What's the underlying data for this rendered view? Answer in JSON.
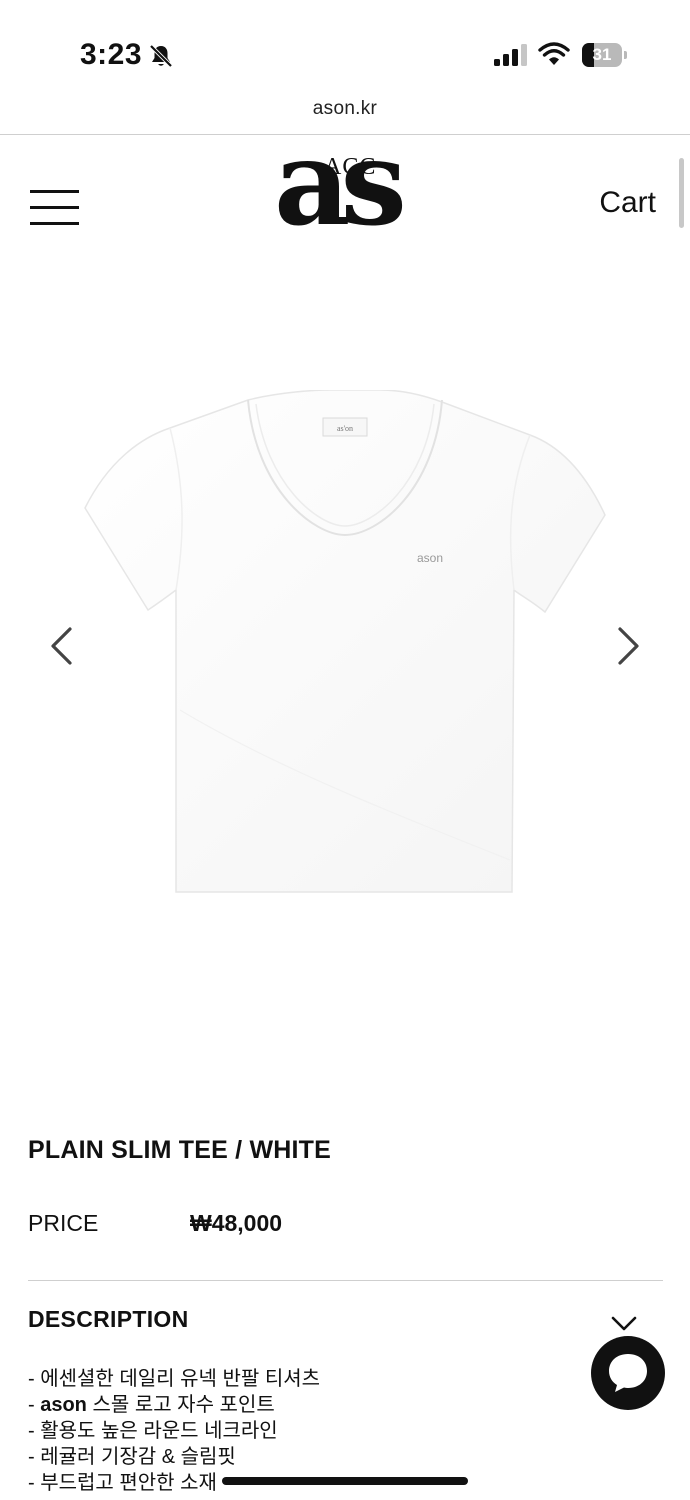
{
  "status_bar": {
    "time": "3:23",
    "battery_text": "31",
    "battery_level": 0.31
  },
  "browser": {
    "url": "ason.kr"
  },
  "header": {
    "logo_sup": "ACC",
    "logo_main": "as",
    "cart_label": "Cart"
  },
  "product": {
    "image_alt": "white short-sleeve scoop neck tee",
    "shirt_label_text": "as'on",
    "chest_logo_text": "ason",
    "title": "PLAIN SLIM TEE / WHITE",
    "price_label": "PRICE",
    "price_value": "₩48,000"
  },
  "description": {
    "header": "DESCRIPTION",
    "lines": [
      "- 에센셜한 데일리 유넥 반팔 티셔츠",
      "스몰 로고 자수 포인트",
      "- 활용도 높은 라운드 네크라인",
      "- 레귤러 기장감 & 슬림핏",
      "- 부드럽고 편안한 소재"
    ],
    "line2_prefix": "- ",
    "line2_bold": "ason"
  },
  "icons": {
    "menu": "hamburger-icon",
    "bell": "bell-slash-icon",
    "signal": "signal-icon",
    "wifi": "wifi-icon",
    "prev": "chevron-left-icon",
    "next": "chevron-right-icon",
    "expand": "chevron-down-icon",
    "chat": "chat-bubble-icon"
  },
  "colors": {
    "text": "#111111",
    "divider": "#cfcfcf",
    "battery_bg": "#b9b9b9"
  }
}
